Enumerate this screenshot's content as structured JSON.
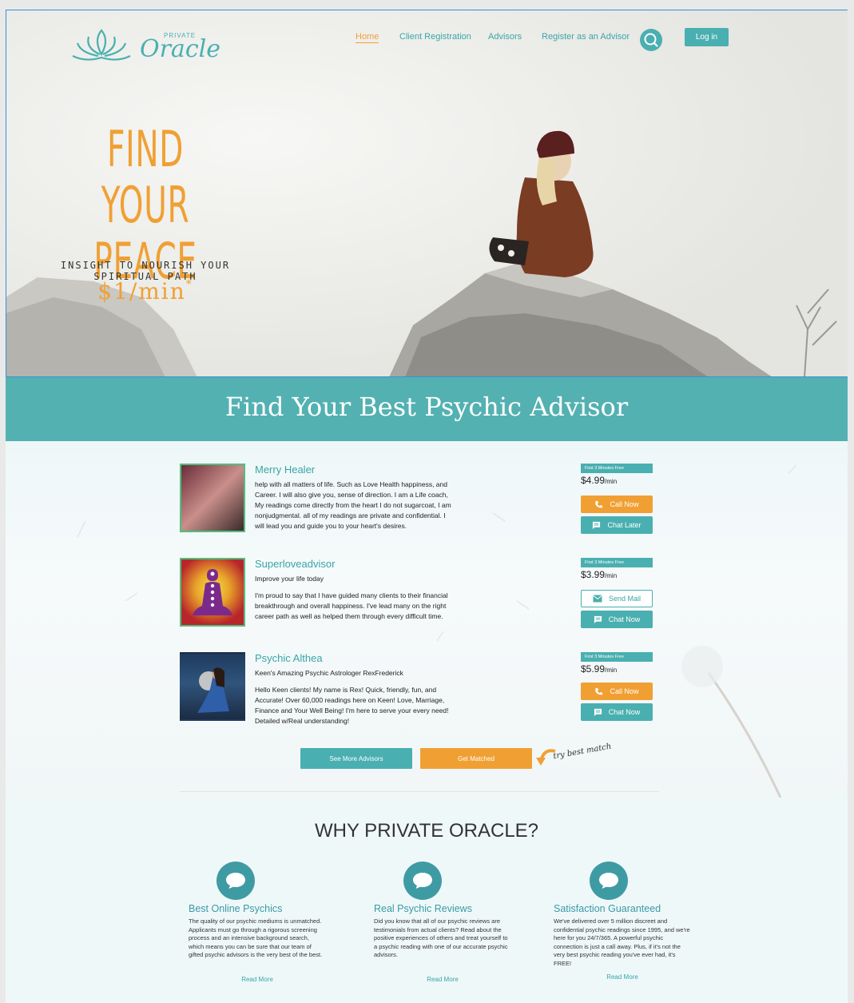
{
  "brand": {
    "small": "PRIVATE",
    "name": "Oracle"
  },
  "nav": {
    "items": [
      "Home",
      "Client Registration",
      "Advisors",
      "Register as an Advisor"
    ],
    "login": "Log in"
  },
  "hero": {
    "line1": "FIND YOUR",
    "line2": "PEACE",
    "subtitle": "INSIGHT TO NOURISH YOUR SPIRITUAL PATH",
    "price": "$1/min",
    "price_mark": "*"
  },
  "band": {
    "title": "Find Your Best Psychic Advisor"
  },
  "advisors": [
    {
      "name": "Merry Healer",
      "tagline": "",
      "bio": "help with all matters of life. Such as Love Health happiness, and Career. I will also give you, sense of direction. I am a Life coach, My readings come directly from the heart I do not sugarcoat, I am nonjudgmental. all of my readings are private and confidential. I will lead you and guide you to your heart's desires.",
      "badge": "First 3 Minutes Free",
      "price": "$4.99",
      "unit": "/min",
      "btn1": "Call Now",
      "btn2": "Chat Later"
    },
    {
      "name": "Superloveadvisor",
      "tagline": "Improve your life today",
      "bio": "I'm proud to say that I have guided many clients to their financial breakthrough and overall happiness. I've lead many on the right career path as well as helped them through every difficult time.",
      "badge": "First 3 Minutes Free",
      "price": "$3.99",
      "unit": "/min",
      "btn1": "Send Mail",
      "btn2": "Chat Now"
    },
    {
      "name": "Psychic Althea",
      "tagline": "Keen's Amazing Psychic Astrologer RexFrederick",
      "bio": "Hello Keen clients! My name is Rex! Quick, friendly, fun, and Accurate! Over 60,000 readings here on Keen! Love, Marriage, Finance and Your Well Being! I'm here to serve your every need! Detailed w/Real understanding!",
      "badge": "First 3 Minutes Free",
      "price": "$5.99",
      "unit": "/min",
      "btn1": "Call Now",
      "btn2": "Chat Now"
    }
  ],
  "actions": {
    "more": "See More Advisors",
    "match": "Get Matched",
    "hint": "try best match"
  },
  "why": {
    "title": "WHY PRIVATE ORACLE?",
    "features": [
      {
        "title": "Best Online Psychics",
        "text": "The quality of our psychic mediums is unmatched. Applicants must go through a rigorous screening process and an intensive background search, which means you can be sure that our team of gifted psychic advisors is the very best of the best.",
        "link": "Read More"
      },
      {
        "title": "Real Psychic Reviews",
        "text": "Did you know that all of our psychic reviews are testimonials from actual clients? Read about the positive experiences of others and treat yourself to a psychic reading with one of our accurate psychic advisors.",
        "link": "Read More"
      },
      {
        "title": "Satisfaction Guaranteed",
        "text": "We've delivered over 5 million discreet and confidential psychic readings since 1995, and we're here for you 24/7/365. A powerful psychic connection is just a call away. Plus, if it's not the very best psychic reading you've ever had, it's FREE!",
        "link": "Read More"
      }
    ]
  },
  "colors": {
    "teal": "#4aafb0",
    "orange": "#f0a033",
    "selection": "#3b8fd6"
  }
}
